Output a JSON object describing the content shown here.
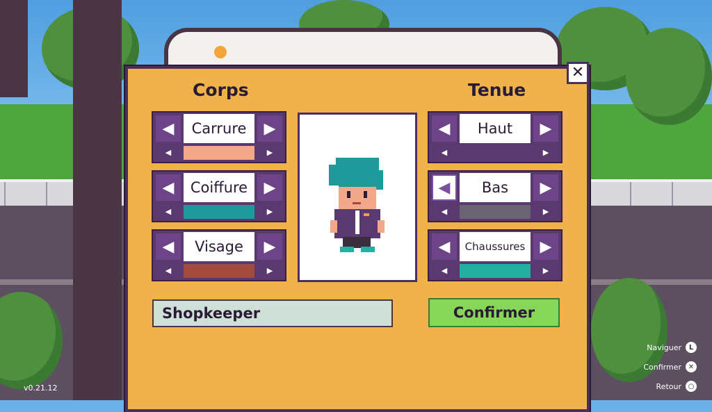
{
  "panel": {
    "close_icon": "close-icon"
  },
  "body_section": {
    "title": "Corps",
    "selectors": [
      {
        "label": "Carrure",
        "swatch": "#f4a88a"
      },
      {
        "label": "Coiffure",
        "swatch": "#1e9a9a"
      },
      {
        "label": "Visage",
        "swatch": "#a24a3c"
      }
    ]
  },
  "outfit_section": {
    "title": "Tenue",
    "selectors": [
      {
        "label": "Haut",
        "swatch": "#5a3870"
      },
      {
        "label": "Bas",
        "swatch": "#6a6470"
      },
      {
        "label": "Chaussures",
        "swatch": "#22b0a0"
      }
    ]
  },
  "name_field": {
    "value": "Shopkeeper"
  },
  "confirm_button": {
    "label": "Confirmer"
  },
  "footer": {
    "version": "v0.21.12",
    "hints": [
      {
        "label": "Naviguer",
        "icon": "L"
      },
      {
        "label": "Confirmer",
        "icon": "✕"
      },
      {
        "label": "Retour",
        "icon": "○"
      }
    ]
  },
  "colors": {
    "panel": "#f0b24a",
    "selector": "#5a3870",
    "confirm": "#86d65a"
  }
}
